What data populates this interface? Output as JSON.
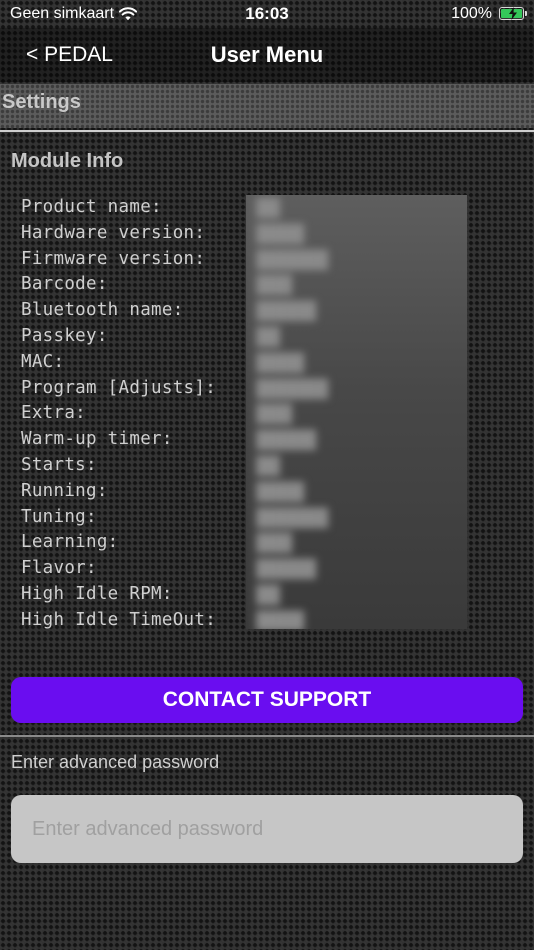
{
  "status_bar": {
    "carrier": "Geen simkaart",
    "time": "16:03",
    "battery_percent": "100%",
    "battery_level": 1.0,
    "battery_charging": true
  },
  "nav": {
    "back_label": "< PEDAL",
    "title": "User Menu"
  },
  "settings": {
    "title": "Settings"
  },
  "module_info": {
    "title": "Module Info",
    "labels": [
      "Product name:",
      "Hardware version:",
      "Firmware version:",
      "Barcode:",
      "Bluetooth name:",
      "Passkey:",
      "MAC:",
      "Program [Adjusts]:",
      "Extra:",
      "Warm-up timer:",
      "Starts:",
      "Running:",
      "Tuning:",
      "Learning:",
      "Flavor:",
      "High Idle RPM:",
      "High Idle TimeOut:"
    ]
  },
  "contact_support": {
    "label": "CONTACT SUPPORT"
  },
  "password": {
    "label": "Enter advanced password",
    "placeholder": "Enter advanced password",
    "value": ""
  },
  "colors": {
    "accent": "#6a0df0",
    "battery": "#34c759",
    "input_bg": "#c6c6c6"
  },
  "icons": {
    "wifi": "wifi-icon",
    "battery": "battery-icon",
    "bolt": "charging-bolt-icon"
  }
}
